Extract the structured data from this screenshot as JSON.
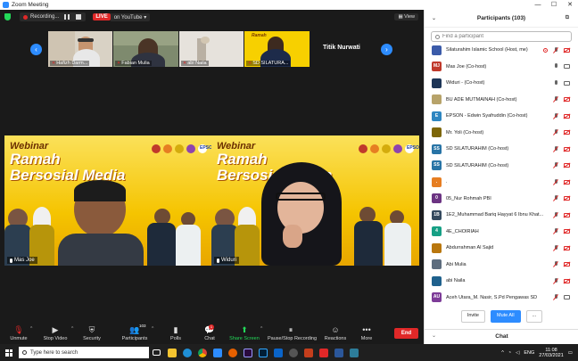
{
  "window": {
    "title": "Zoom Meeting"
  },
  "topbar": {
    "recording_label": "Recording...",
    "live_label": "LIVE",
    "live_on": "on YouTube",
    "view_label": "View"
  },
  "thumbnails": [
    {
      "name": "Hafizh Darm..."
    },
    {
      "name": "Fabian Mulia"
    },
    {
      "name": "abi Naila"
    },
    {
      "name": "SD SILATURA..."
    },
    {
      "name": "Titik Nurwati"
    }
  ],
  "webinar": {
    "line1": "Webinar",
    "line2": "Ramah",
    "line3": "Bersosial Media",
    "epson": "EPSON"
  },
  "main_videos": [
    {
      "name": "Mas Joe"
    },
    {
      "name": "Widuri"
    }
  ],
  "toolbar": {
    "unmute": "Unmute",
    "stop_video": "Stop Video",
    "security": "Security",
    "participants": "Participants",
    "participants_count": "103",
    "polls": "Polls",
    "chat": "Chat",
    "chat_badge": "1",
    "share_screen": "Share Screen",
    "pause_stop": "Pause/Stop Recording",
    "reactions": "Reactions",
    "more": "More",
    "end": "End"
  },
  "panel": {
    "title": "Participants (103)",
    "search_placeholder": "Find a participant",
    "participants": [
      {
        "name": "Silaturahim Islamic School (Host, me)",
        "initials": "",
        "color": "#3b5ba9",
        "rec": true,
        "mic": "off",
        "cam": "off"
      },
      {
        "name": "Mas Joe (Co-host)",
        "initials": "MJ",
        "color": "#c0392b",
        "rec": false,
        "mic": "on",
        "cam": "on"
      },
      {
        "name": "Widuri - (Co-host)",
        "initials": "",
        "color": "#1d3557",
        "rec": false,
        "mic": "on",
        "cam": "on"
      },
      {
        "name": "BU ADE MUTMAINAH (Co-host)",
        "initials": "",
        "color": "#b7a36a",
        "rec": false,
        "mic": "off",
        "cam": "off"
      },
      {
        "name": "EPSON - Edwin Syafruddin (Co-host)",
        "initials": "E",
        "color": "#2e86c1",
        "rec": false,
        "mic": "off",
        "cam": "off"
      },
      {
        "name": "Mr. Yoli (Co-host)",
        "initials": "",
        "color": "#7d6608",
        "rec": false,
        "mic": "off",
        "cam": "off"
      },
      {
        "name": "SD SILATURAHIM (Co-host)",
        "initials": "SS",
        "color": "#2874a6",
        "rec": false,
        "mic": "off",
        "cam": "off"
      },
      {
        "name": "SD SILATURAHIM (Co-host)",
        "initials": "SS",
        "color": "#2874a6",
        "rec": false,
        "mic": "off",
        "cam": "off"
      },
      {
        "name": ".",
        "initials": ".",
        "color": "#e67e22",
        "rec": false,
        "mic": "off",
        "cam": "off"
      },
      {
        "name": "05_Nur Rohmah PBI",
        "initials": "0",
        "color": "#6c3483",
        "rec": false,
        "mic": "off",
        "cam": "off"
      },
      {
        "name": "1E2_Muhammad Bariq Hayyat 6 Ibnu Khat...",
        "initials": "1B",
        "color": "#34495e",
        "rec": false,
        "mic": "off",
        "cam": "off"
      },
      {
        "name": "4E_CHOIRIAH",
        "initials": "4",
        "color": "#16a085",
        "rec": false,
        "mic": "off",
        "cam": "off"
      },
      {
        "name": "Abdurrahman Al Sajid",
        "initials": "",
        "color": "#b9770e",
        "rec": false,
        "mic": "off",
        "cam": "off"
      },
      {
        "name": "Abi Mulia",
        "initials": "",
        "color": "#5d6d7e",
        "rec": false,
        "mic": "off",
        "cam": "off"
      },
      {
        "name": "abi Naila",
        "initials": "",
        "color": "#1f618d",
        "rec": false,
        "mic": "off",
        "cam": "off"
      },
      {
        "name": "Aceh Utara_M. Nasir, S.Pd Pengawas SD",
        "initials": "AU",
        "color": "#7d3c98",
        "rec": false,
        "mic": "off",
        "cam": "on"
      }
    ],
    "invite": "Invite",
    "mute_all": "Mute All",
    "more": "...",
    "chat_title": "Chat"
  },
  "taskbar": {
    "search_placeholder": "Type here to search",
    "lang": "ENG",
    "time": "11:08",
    "date": "27/03/2021"
  }
}
